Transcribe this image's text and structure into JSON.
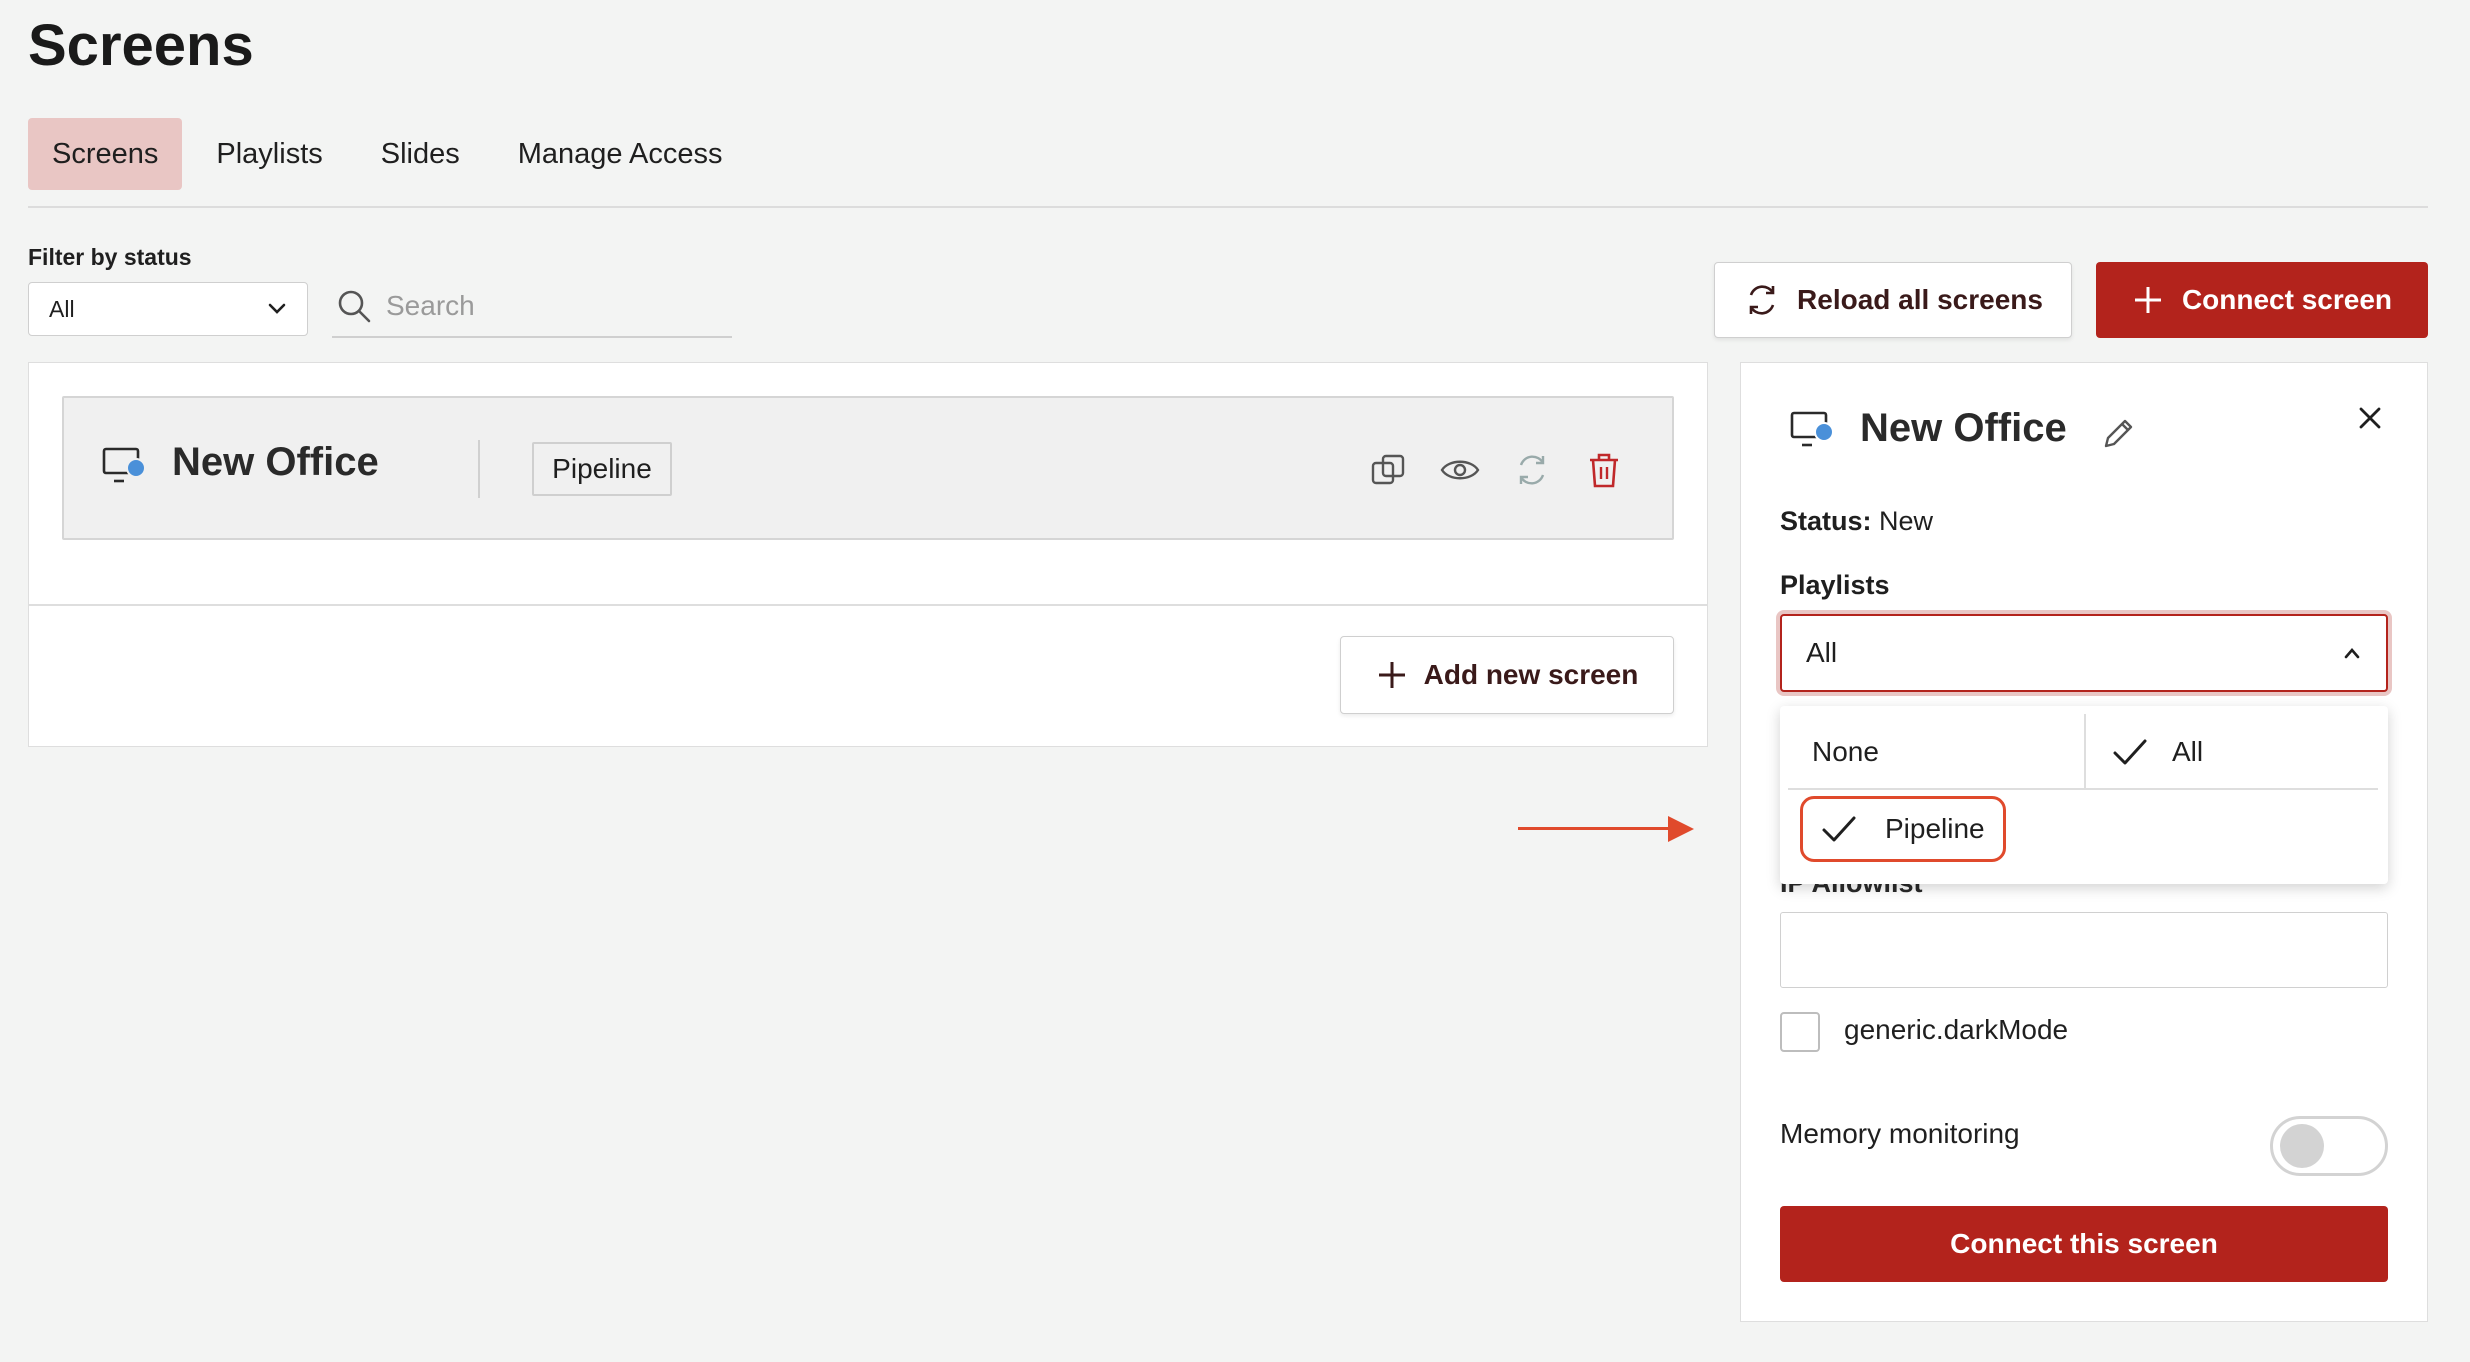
{
  "page": {
    "title": "Screens"
  },
  "tabs": [
    {
      "label": "Screens",
      "active": true
    },
    {
      "label": "Playlists",
      "active": false
    },
    {
      "label": "Slides",
      "active": false
    },
    {
      "label": "Manage Access",
      "active": false
    }
  ],
  "filter": {
    "label": "Filter by status",
    "value": "All"
  },
  "search": {
    "placeholder": "Search"
  },
  "actions": {
    "reload_label": "Reload all screens",
    "connect_label": "Connect screen"
  },
  "screen_card": {
    "name": "New Office",
    "playlist_tag": "Pipeline"
  },
  "add_screen": {
    "label": "Add new screen"
  },
  "details": {
    "title": "New Office",
    "status_label": "Status:",
    "status_value": "New",
    "playlists_label": "Playlists",
    "playlists_value": "All",
    "dropdown_options": {
      "none": "None",
      "all": "All",
      "pipeline": "Pipeline"
    },
    "allowlist_label": "IP Allowlist",
    "darkmode_label": "generic.darkMode",
    "memory_label": "Memory monitoring",
    "memory_enabled": false,
    "connect_label": "Connect this screen"
  },
  "colors": {
    "accent": "#b3231c",
    "active_tab": "#e9c6c4",
    "annotation": "#e04a2c",
    "status_dot": "#4a90d9"
  }
}
